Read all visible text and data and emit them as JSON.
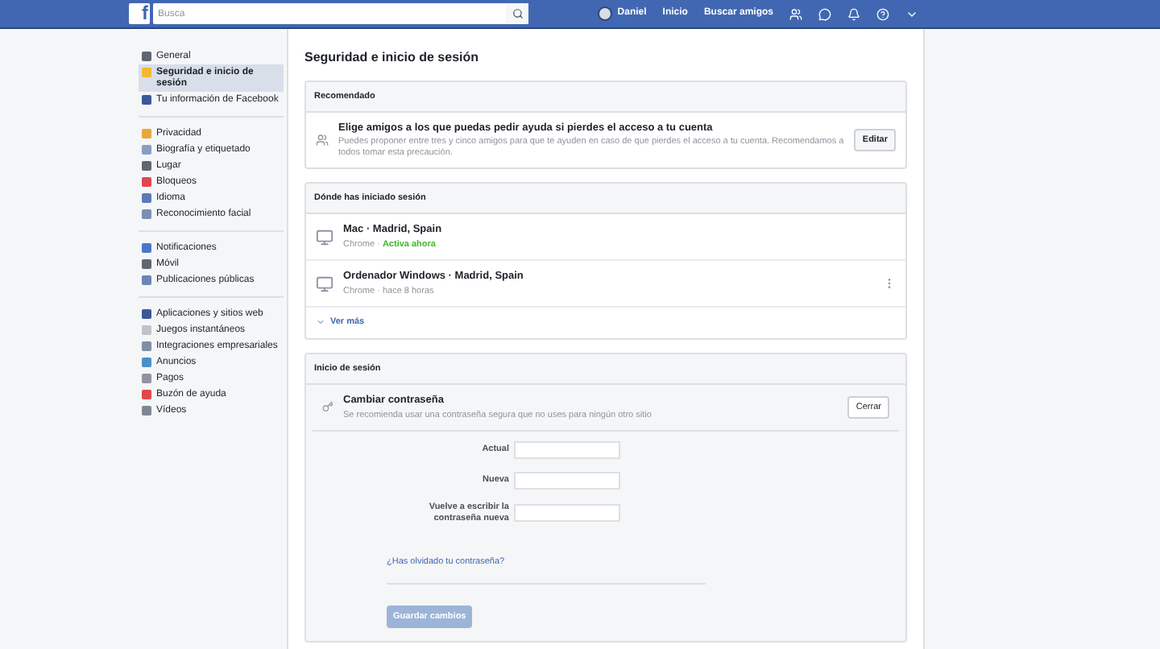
{
  "topbar": {
    "logo": "f",
    "search": {
      "placeholder": "Busca"
    },
    "user": "Daniel",
    "links": [
      "Inicio",
      "Buscar amigos"
    ]
  },
  "sidebar": {
    "groups": [
      [
        {
          "label": "General",
          "selected": false,
          "color": "#606770"
        },
        {
          "label": "Seguridad e inicio de sesión",
          "selected": true,
          "color": "#f5b82e"
        },
        {
          "label": "Tu información de Facebook",
          "selected": false,
          "color": "#3b5998"
        }
      ],
      [
        {
          "label": "Privacidad",
          "selected": false,
          "color": "#e9a93a"
        },
        {
          "label": "Biografía y etiquetado",
          "selected": false,
          "color": "#8b9dc3"
        },
        {
          "label": "Lugar",
          "selected": false,
          "color": "#606770"
        },
        {
          "label": "Bloqueos",
          "selected": false,
          "color": "#e0474c"
        },
        {
          "label": "Idioma",
          "selected": false,
          "color": "#5b7bb8"
        },
        {
          "label": "Reconocimiento facial",
          "selected": false,
          "color": "#7b8fb3"
        }
      ],
      [
        {
          "label": "Notificaciones",
          "selected": false,
          "color": "#4a76c8"
        },
        {
          "label": "Móvil",
          "selected": false,
          "color": "#606770"
        },
        {
          "label": "Publicaciones públicas",
          "selected": false,
          "color": "#6d84b4"
        }
      ],
      [
        {
          "label": "Aplicaciones y sitios web",
          "selected": false,
          "color": "#3b5998"
        },
        {
          "label": "Juegos instantáneos",
          "selected": false,
          "color": "#bec3c9"
        },
        {
          "label": "Integraciones empresariales",
          "selected": false,
          "color": "#7f8fa6"
        },
        {
          "label": "Anuncios",
          "selected": false,
          "color": "#4a90c8"
        },
        {
          "label": "Pagos",
          "selected": false,
          "color": "#8d949e"
        },
        {
          "label": "Buzón de ayuda",
          "selected": false,
          "color": "#e0474c"
        },
        {
          "label": "Vídeos",
          "selected": false,
          "color": "#7f8794"
        }
      ]
    ]
  },
  "main": {
    "title": "Seguridad e inicio de sesión",
    "recommended": {
      "heading": "Recomendado",
      "title": "Elige amigos a los que puedas pedir ayuda si pierdes el acceso a tu cuenta",
      "text": "Puedes proponer entre tres y cinco amigos para que te ayuden en caso de que pierdes el acceso a tu cuenta. Recomendamos a todos tomar esta precaución.",
      "button": "Editar"
    },
    "sessions": {
      "heading": "Dónde has iniciado sesión",
      "items": [
        {
          "device": "Mac · Madrid, Spain",
          "browser": "Chrome ·",
          "status": "Activa ahora",
          "active": true
        },
        {
          "device": "Ordenador Windows · Madrid, Spain",
          "browser": "Chrome ·",
          "status": "hace 8 horas",
          "active": false
        }
      ],
      "more": "Ver más"
    },
    "login": {
      "heading": "Inicio de sesión",
      "title": "Cambiar contraseña",
      "text": "Se recomienda usar una contraseña segura que no uses para ningún otro sitio",
      "button": "Cerrar",
      "fields": [
        "Actual",
        "Nueva",
        "Vuelve a escribir la contraseña nueva"
      ],
      "forgot": "¿Has olvidado tu contraseña?",
      "save": {
        "label": "Guardar cambios",
        "disabled": true
      }
    }
  }
}
